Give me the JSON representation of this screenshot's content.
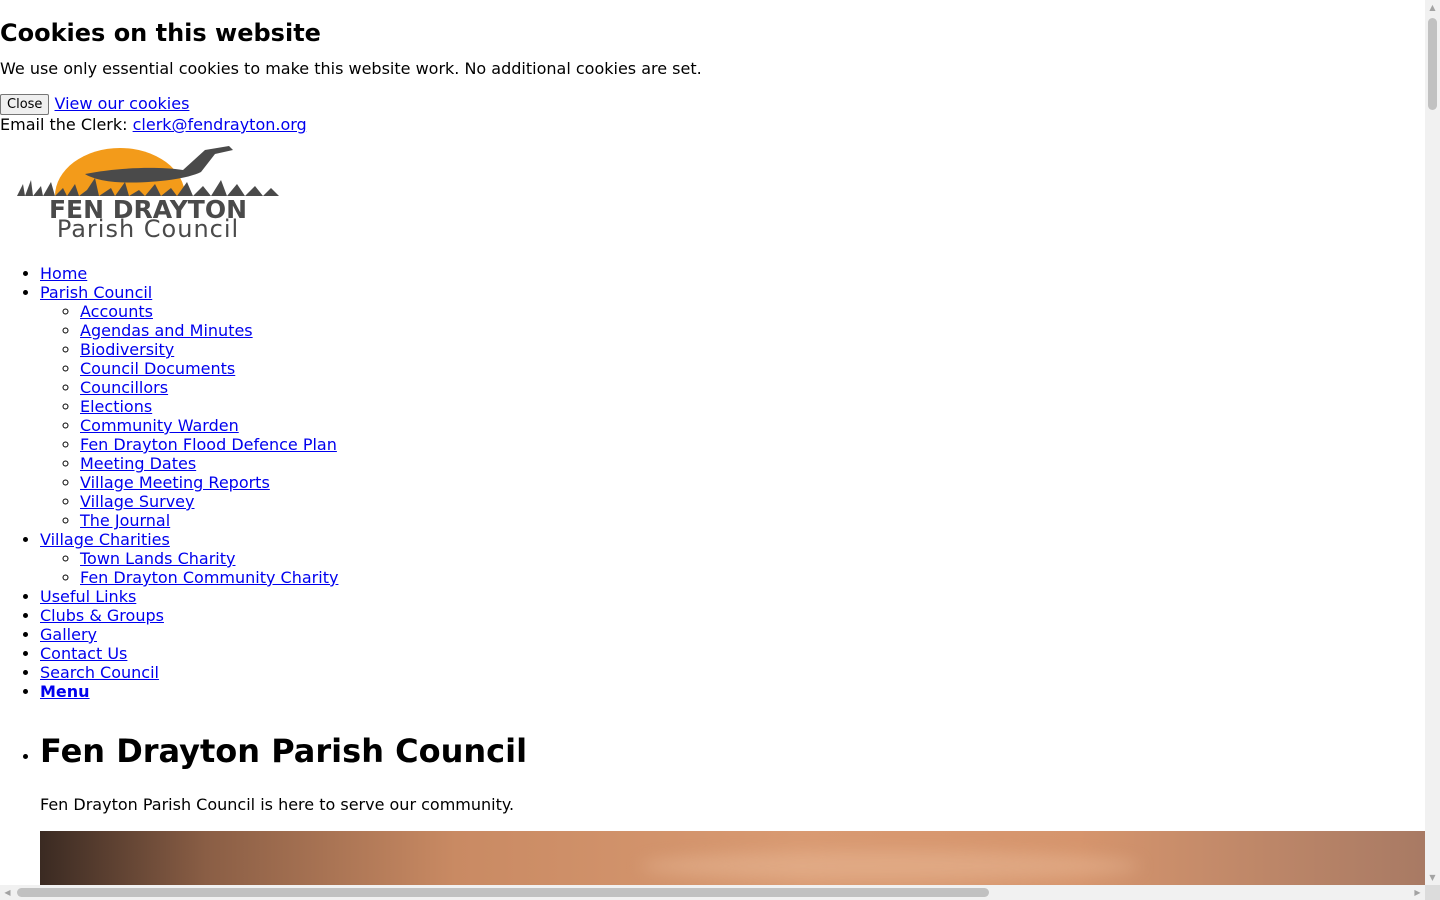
{
  "cookie_banner": {
    "title": "Cookies on this website",
    "text": "We use only essential cookies to make this website work. No additional cookies are set.",
    "close_label": "Close",
    "view_link": "View our cookies"
  },
  "clerk": {
    "label": "Email the Clerk: ",
    "email": "clerk@fendrayton.org"
  },
  "logo": {
    "line1": "FEN DRAYTON",
    "line2": "Parish Council",
    "sun_color": "#f39b1a",
    "dark_color": "#4a4a4a"
  },
  "nav": {
    "home": "Home",
    "parish_council": {
      "label": "Parish Council",
      "children": [
        "Accounts",
        "Agendas and Minutes",
        "Biodiversity",
        "Council Documents",
        "Councillors",
        "Elections",
        "Community Warden",
        "Fen Drayton Flood Defence Plan",
        "Meeting Dates",
        "Village Meeting Reports",
        "Village Survey",
        "The Journal"
      ]
    },
    "village_charities": {
      "label": "Village Charities",
      "children": [
        "Town Lands Charity",
        "Fen Drayton Community Charity"
      ]
    },
    "useful_links": "Useful Links",
    "clubs_groups": "Clubs & Groups",
    "gallery": "Gallery",
    "contact_us": "Contact Us",
    "search_council": "Search Council",
    "menu": "Menu"
  },
  "main": {
    "title": "Fen Drayton Parish Council",
    "intro": "Fen Drayton Parish Council is here to serve our community."
  },
  "colors": {
    "link": "#0000ee",
    "text": "#000000"
  }
}
